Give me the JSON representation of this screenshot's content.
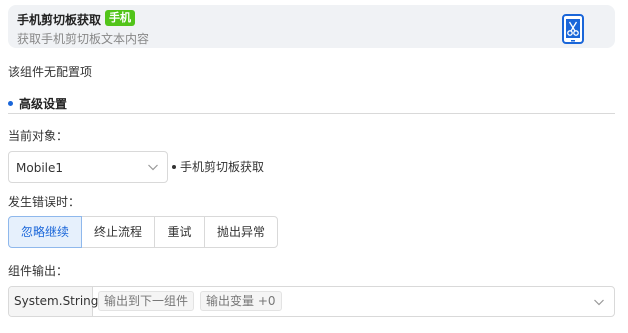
{
  "header": {
    "title": "手机剪切板获取",
    "badge": "手机",
    "description": "获取手机剪切板文本内容",
    "icon": "phone-scissors-icon",
    "icon_color": "#1a66d9",
    "badge_color": "#52c41a"
  },
  "no_config_text": "该组件无配置项",
  "advanced": {
    "title": "高级设置",
    "current_object_label": "当前对象：",
    "current_object_value": "Mobile1",
    "current_object_note": "手机剪切板获取",
    "on_error_label": "发生错误时：",
    "on_error_options": [
      "忽略继续",
      "终止流程",
      "重试",
      "抛出异常"
    ],
    "on_error_selected": "忽略继续",
    "output_label": "组件输出：",
    "output_type": "System.String",
    "output_tags": [
      "输出到下一组件",
      "输出变量 +0"
    ]
  },
  "accent_color": "#1a66d9"
}
